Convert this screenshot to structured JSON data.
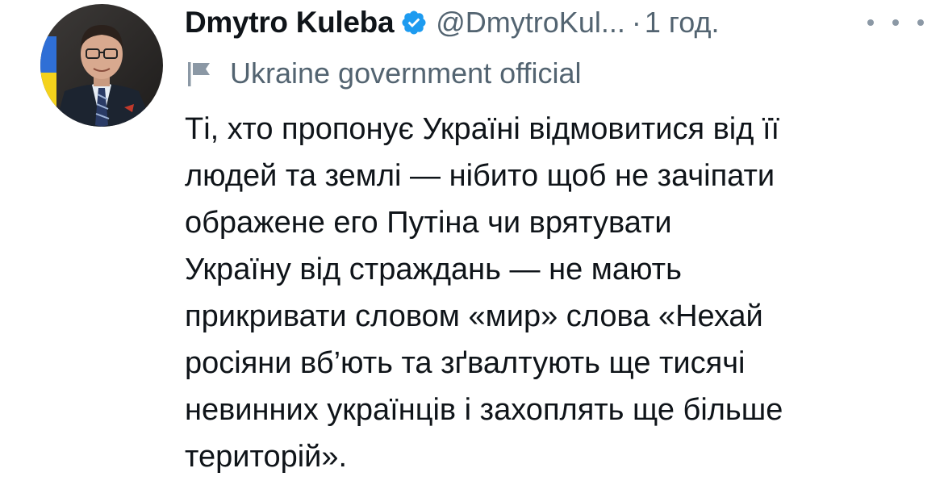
{
  "author": {
    "display_name": "Dmytro Kuleba",
    "handle": "@DmytroKul...",
    "separator": "·",
    "timestamp": "1 год.",
    "verified": true,
    "verified_icon": "verified-badge-icon",
    "avatar_icon": "profile-avatar"
  },
  "more_menu_icon": "more-horizontal-icon",
  "account_label": {
    "icon": "flag-icon",
    "text": "Ukraine government official"
  },
  "tweet": {
    "lines": [
      "Ті, хто пропонує Україні відмовитися від її",
      "людей та землі — нібито щоб не зачіпати",
      "ображене его Путіна чи врятувати",
      "Україну від страждань — не мають",
      "прикривати словом «мир» слова «Нехай",
      "росіяни вб’ють та зґвалтують ще тисячі",
      "невинних українців і захоплять ще більше",
      "територій»."
    ]
  },
  "colors": {
    "text_primary": "#0f1419",
    "text_secondary": "#536471",
    "verified_blue": "#1d9bf0",
    "background": "#ffffff"
  }
}
